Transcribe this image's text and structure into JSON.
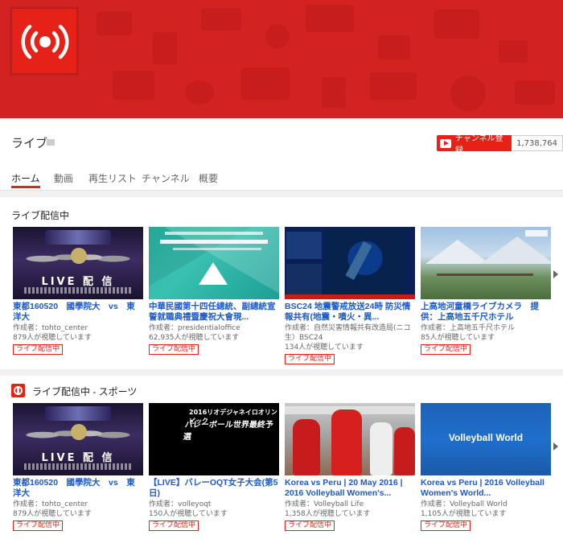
{
  "channel": {
    "name": "ライブ",
    "subscribe_label": "チャンネル登録",
    "subscriber_count": "1,738,764",
    "brand_color": "#e62117"
  },
  "tabs": [
    {
      "label": "ホーム",
      "active": true
    },
    {
      "label": "動画"
    },
    {
      "label": "再生リスト"
    },
    {
      "label": "チャンネル"
    },
    {
      "label": "概要"
    }
  ],
  "sections": [
    {
      "title": "ライブ配信中",
      "videos": [
        {
          "title": "東都160520　國學院大　vs　東洋大",
          "author": "作成者：tohto_center",
          "viewers": "879人が視聴しています",
          "badge": "ライブ配信中",
          "thumb_text": "LIVE 配 信"
        },
        {
          "title": "中華民國第十四任總統、副總統宣誓就職典禮暨慶祝大會現...",
          "author": "作成者：presidentialoffice",
          "viewers": "62,935人が視聴しています",
          "badge": "ライブ配信中"
        },
        {
          "title": "BSC24 地震警戒放送24時 防災情報共有(地震・噴火・異...",
          "author": "作成者：自然災害情報共有改造局(ニコ生）BSC24",
          "viewers": "134人が視聴しています",
          "badge": "ライブ配信中"
        },
        {
          "title": "上高地河童橋ライブカメラ　提供：上高地五千尺ホテル",
          "author": "作成者：上高地五千尺ホテル",
          "viewers": "85人が視聴しています",
          "badge": "ライブ配信中"
        }
      ]
    },
    {
      "title": "ライブ配信中 - スポーツ",
      "videos": [
        {
          "title": "東都160520　國學院大　vs　東洋大",
          "author": "作成者：tohto_center",
          "viewers": "879人が視聴しています",
          "badge": "ライブ配信中",
          "thumb_text": "LIVE 配 信"
        },
        {
          "title": "【LIVE】バレーOQT女子大会(第5日)",
          "author": "作成者：volleyoqt",
          "viewers": "150人が視聴しています",
          "badge": "ライブ配信中",
          "thumb_text_1": "2016リオデジャネイロオリンピック",
          "thumb_text_2": "バレーボール世界最終予選"
        },
        {
          "title": "Korea vs Peru | 20 May 2016 | 2016 Volleyball Women's...",
          "author": "作成者：Volleyball Life",
          "viewers": "1,358人が視聴しています",
          "badge": "ライブ配信中"
        },
        {
          "title": "Korea vs Peru | 2016 Volleyball Women's World...",
          "author": "作成者：Volleyball World",
          "viewers": "1,105人が視聴しています",
          "badge": "ライブ配信中",
          "thumb_text": "Volleyball World"
        }
      ]
    }
  ]
}
